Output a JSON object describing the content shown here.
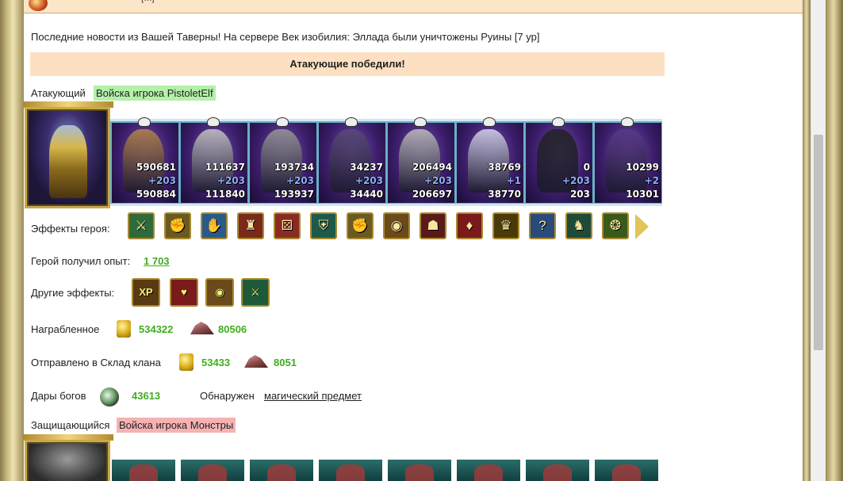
{
  "window": {
    "top_title": "[...]"
  },
  "news": {
    "text": "Последние новости из Вашей Таверны! На сервере Век изобилия: Эллада были уничтожены Руины [7 ур]"
  },
  "result": {
    "banner": "Атакующие победили!"
  },
  "attacker": {
    "label": "Атакующий",
    "tag": "Войска игрока PistoletElf",
    "units": [
      {
        "before": "590681",
        "bonus": "+203",
        "after": "590884"
      },
      {
        "before": "111637",
        "bonus": "+203",
        "after": "111840"
      },
      {
        "before": "193734",
        "bonus": "+203",
        "after": "193937"
      },
      {
        "before": "34237",
        "bonus": "+203",
        "after": "34440"
      },
      {
        "before": "206494",
        "bonus": "+203",
        "after": "206697"
      },
      {
        "before": "38769",
        "bonus": "+1",
        "after": "38770"
      },
      {
        "before": "0",
        "bonus": "+203",
        "after": "203"
      },
      {
        "before": "10299",
        "bonus": "+2",
        "after": "10301"
      }
    ]
  },
  "hero_effects": {
    "label": "Эффекты героя:",
    "icons": [
      "sword-icon",
      "handshake-sword-icon",
      "hand-icon",
      "fortress-icon",
      "dice-icon",
      "shield-icon",
      "handshake-shield-icon",
      "coins-icon",
      "helmet-icon",
      "armor-icon",
      "treasure-icon",
      "question-icon",
      "boots-icon",
      "amulet-icon"
    ]
  },
  "experience": {
    "label": "Герой получил опыт:",
    "value": "1 703"
  },
  "other_effects": {
    "label": "Другие эффекты:",
    "icons": [
      "xp-icon",
      "heart-sword-icon",
      "coins-icon",
      "sword-icon"
    ],
    "xp_text": "XP"
  },
  "rewarded": {
    "label": "Награбленное",
    "gold": "534322",
    "ore": "80506"
  },
  "clan_storage": {
    "label": "Отправлено в Склад клана",
    "gold": "53433",
    "ore": "8051"
  },
  "gods_gifts": {
    "label": "Дары богов",
    "value": "43613",
    "found_label": "Обнаружен",
    "found_item": "магический предмет"
  },
  "defender": {
    "label": "Защищающийся",
    "tag": "Войска игрока Монстры"
  },
  "colors": {
    "green": "#3fae1c",
    "banner_bg": "#fde0c2",
    "attacker_tag": "#b4f0a8",
    "defender_tag": "#f5b2b2"
  }
}
